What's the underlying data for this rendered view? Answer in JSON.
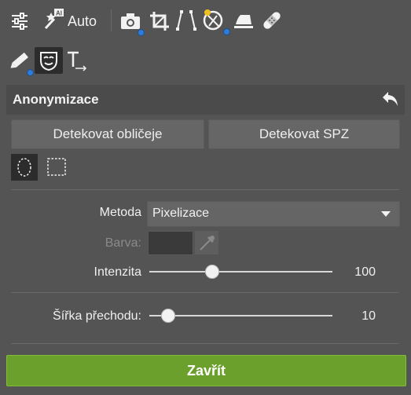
{
  "toolbar": {
    "auto_label": "Auto",
    "icons_row1": [
      "adjustments-sliders-icon",
      "ai-magic-wand-icon",
      "camera-icon",
      "crop-icon",
      "perspective-icon",
      "lens-correction-icon",
      "iron-icon",
      "bandage-icon"
    ],
    "icons_row2": [
      "eraser-brush-icon",
      "anonymize-mask-icon",
      "text-tool-icon"
    ]
  },
  "panel": {
    "title": "Anonymizace",
    "detect_faces_label": "Detekovat obličeje",
    "detect_plates_label": "Detekovat SPZ"
  },
  "method": {
    "label": "Metoda",
    "selected": "Pixelizace"
  },
  "color": {
    "label": "Barva:",
    "swatch": "#3a3a3a"
  },
  "intensity": {
    "label": "Intenzita",
    "value": "100",
    "fraction": 0.34
  },
  "transition_width": {
    "label": "Šířka přechodu:",
    "value": "10",
    "fraction": 0.1
  },
  "footer": {
    "close_label": "Zavřít"
  },
  "colors": {
    "accent": "#2f7bd8",
    "close_button": "#6aa02b",
    "panel_bg": "#545454"
  }
}
